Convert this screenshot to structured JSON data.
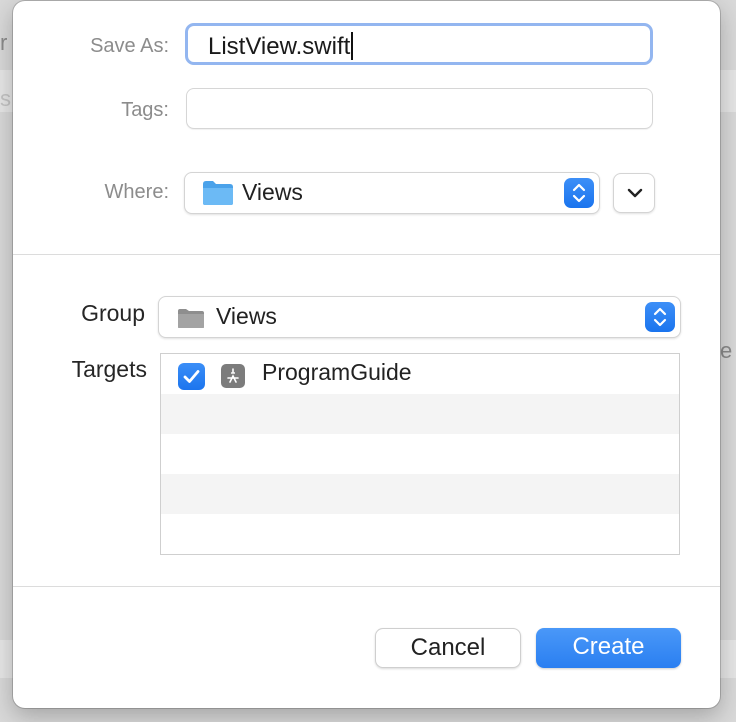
{
  "form": {
    "save_as_label": "Save As:",
    "save_as_value": "ListView.swift",
    "tags_label": "Tags:",
    "tags_value": "",
    "where_label": "Where:",
    "where_value": "Views"
  },
  "project": {
    "group_label": "Group",
    "group_value": "Views",
    "targets_label": "Targets",
    "targets": [
      {
        "name": "ProgramGuide",
        "checked": true,
        "icon": "app-target-icon"
      }
    ]
  },
  "buttons": {
    "cancel": "Cancel",
    "create": "Create"
  },
  "colors": {
    "accent": "#2a7ff1",
    "folder_blue": "#5aaff0",
    "folder_gray": "#9a9a9a",
    "focus_ring": "#93b6f0"
  }
}
